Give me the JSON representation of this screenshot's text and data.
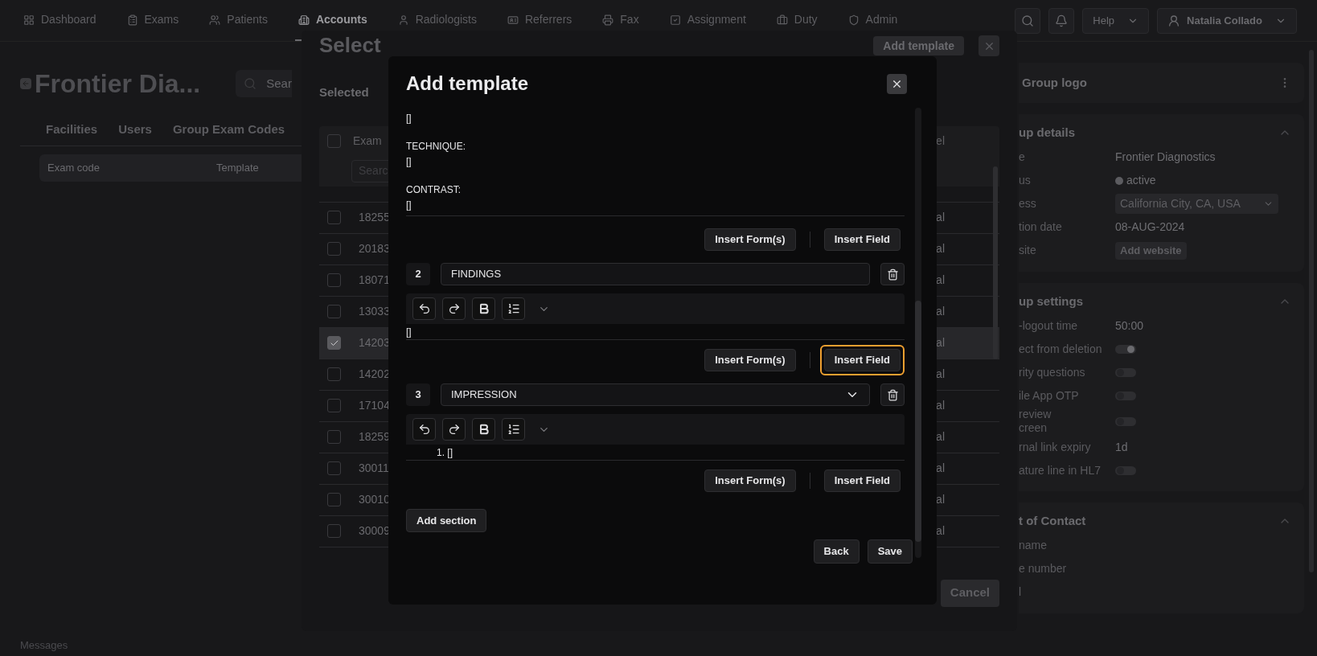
{
  "nav": {
    "items": [
      {
        "label": "Dashboard",
        "selected": false
      },
      {
        "label": "Exams",
        "selected": false
      },
      {
        "label": "Patients",
        "selected": false
      },
      {
        "label": "Accounts",
        "selected": true
      },
      {
        "label": "Radiologists",
        "selected": false
      },
      {
        "label": "Referrers",
        "selected": false
      },
      {
        "label": "Fax",
        "selected": false
      },
      {
        "label": "Assignment",
        "selected": false
      },
      {
        "label": "Duty",
        "selected": false
      },
      {
        "label": "Admin",
        "selected": false
      }
    ],
    "help": "Help",
    "user": "Natalia Collado"
  },
  "page": {
    "title": "Frontier Dia...",
    "search_placeholder": "Sear",
    "tabs": [
      "Facilities",
      "Users",
      "Group Exam Codes"
    ],
    "columns": [
      "Exam code",
      "Template"
    ],
    "footer": "Messages"
  },
  "side_panel": {
    "logo_title": "Group logo",
    "details": {
      "title": "up details",
      "rows": [
        {
          "label": "e",
          "kind": "text",
          "value": "Frontier Diagnostics"
        },
        {
          "label": "us",
          "kind": "status",
          "value": "active",
          "color": "#5c5c60"
        },
        {
          "label": "ess",
          "kind": "select",
          "value": "California City, CA, USA"
        },
        {
          "label": "tion date",
          "kind": "text",
          "value": "08-AUG-2024"
        },
        {
          "label": "site",
          "kind": "button",
          "value": "Add website"
        }
      ]
    },
    "settings": {
      "title": "up settings",
      "rows": [
        {
          "label": "-logout time",
          "kind": "text",
          "value": "50:00"
        },
        {
          "label": "ect from deletion",
          "kind": "toggle",
          "on": true
        },
        {
          "label": "rity questions",
          "kind": "toggle",
          "on": false
        },
        {
          "label": "ile App OTP",
          "kind": "toggle",
          "on": false
        },
        {
          "label": "review\ncreen",
          "kind": "toggle",
          "on": false
        },
        {
          "label": "rnal link expiry",
          "kind": "text",
          "value": "1d"
        },
        {
          "label": "ature line in HL7",
          "kind": "toggle",
          "on": false
        }
      ]
    },
    "contact": {
      "title": "t of Contact",
      "rows": [
        {
          "label": "name"
        },
        {
          "label": "e number"
        },
        {
          "label": "l"
        }
      ]
    }
  },
  "select_modal": {
    "title": "Select",
    "add_button": "Add template",
    "selected_label": "Selected",
    "header": {
      "checked": false,
      "column_1": "Exam",
      "column_2": "el"
    },
    "search_placeholder": "Searc",
    "rows": [
      {
        "code": "18255",
        "column_2": "al",
        "checked": false
      },
      {
        "code": "20183",
        "column_2": "al",
        "checked": false
      },
      {
        "code": "18071",
        "column_2": "al",
        "checked": false
      },
      {
        "code": "13033",
        "column_2": "al",
        "checked": false
      },
      {
        "code": "14203",
        "column_2": "al",
        "checked": true
      },
      {
        "code": "14202",
        "column_2": "al",
        "checked": false
      },
      {
        "code": "17104",
        "column_2": "al",
        "checked": false
      },
      {
        "code": "18259",
        "column_2": "al",
        "checked": false
      },
      {
        "code": "30011",
        "column_2": "al",
        "checked": false
      },
      {
        "code": "30010",
        "column_2": "al",
        "checked": false
      },
      {
        "code": "30009",
        "column_2": "al",
        "checked": false
      }
    ],
    "cancel": "Cancel"
  },
  "template_modal": {
    "title": "Add template",
    "intro": {
      "paragraphs": [
        [
          "[]"
        ],
        [
          "TECHNIQUE:",
          "[]"
        ],
        [
          "CONTRAST:",
          "[]"
        ]
      ],
      "actions": [
        {
          "label": "Insert Form(s)",
          "focused": false
        },
        {
          "label": "Insert Field",
          "focused": false
        }
      ]
    },
    "sections": [
      {
        "number": "2",
        "name": "FINDINGS",
        "kind": "input",
        "body": {
          "kind": "plain",
          "text": "[]"
        },
        "actions": [
          {
            "label": "Insert Form(s)",
            "focused": false
          },
          {
            "label": "Insert Field",
            "focused": true
          }
        ]
      },
      {
        "number": "3",
        "name": "IMPRESSION",
        "kind": "select",
        "body": {
          "kind": "list",
          "marker": "1.",
          "text": "[]"
        },
        "actions": [
          {
            "label": "Insert Form(s)",
            "focused": false
          },
          {
            "label": "Insert Field",
            "focused": false
          }
        ]
      }
    ],
    "add_section": "Add section",
    "back": "Back",
    "save": "Save"
  }
}
